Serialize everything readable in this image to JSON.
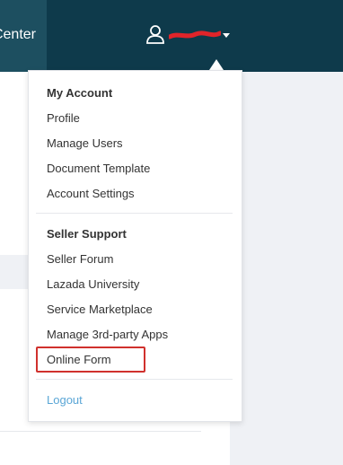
{
  "header": {
    "nav_tab_label": "Center",
    "user_icon": "user-icon"
  },
  "dropdown": {
    "my_account": {
      "heading": "My Account",
      "items": [
        "Profile",
        "Manage Users",
        "Document Template",
        "Account Settings"
      ]
    },
    "seller_support": {
      "heading": "Seller Support",
      "items": [
        "Seller Forum",
        "Lazada University",
        "Service Marketplace",
        "Manage 3rd-party Apps",
        "Online Form"
      ]
    },
    "logout_label": "Logout"
  },
  "colors": {
    "topbar": "#0e3a4b",
    "logout_link": "#5aa6d6",
    "highlight": "#d0312d"
  }
}
